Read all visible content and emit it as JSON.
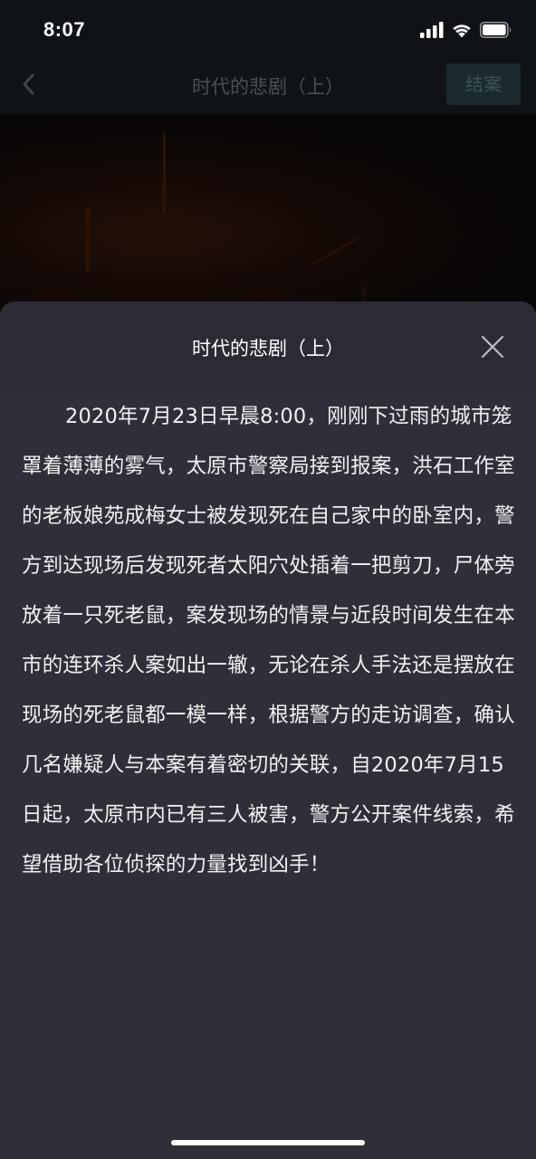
{
  "status_bar": {
    "time": "8:07",
    "icons": [
      "cellular-signal-icon",
      "wifi-icon",
      "battery-icon"
    ]
  },
  "nav": {
    "back_icon": "chevron-left-icon",
    "title": "时代的悲剧（上）",
    "close_case_label": "结案"
  },
  "sheet": {
    "title": "时代的悲剧（上）",
    "close_icon": "close-icon",
    "body": "2020年7月23日早晨8:00，刚刚下过雨的城市笼罩着薄薄的雾气，太原市警察局接到报案，洪石工作室的老板娘苑成梅女士被发现死在自己家中的卧室内，警方到达现场后发现死者太阳穴处插着一把剪刀，尸体旁放着一只死老鼠，案发现场的情景与近段时间发生在本市的连环杀人案如出一辙，无论在杀人手法还是摆放在现场的死老鼠都一模一样，根据警方的走访调查，确认几名嫌疑人与本案有着密切的关联，自2020年7月15日起，太原市内已有三人被害，警方公开案件线索，希望借助各位侦探的力量找到凶手！"
  },
  "colors": {
    "sheet_background": "#302f39",
    "nav_background": "#101417",
    "close_case_button": "#1a2a2d"
  }
}
